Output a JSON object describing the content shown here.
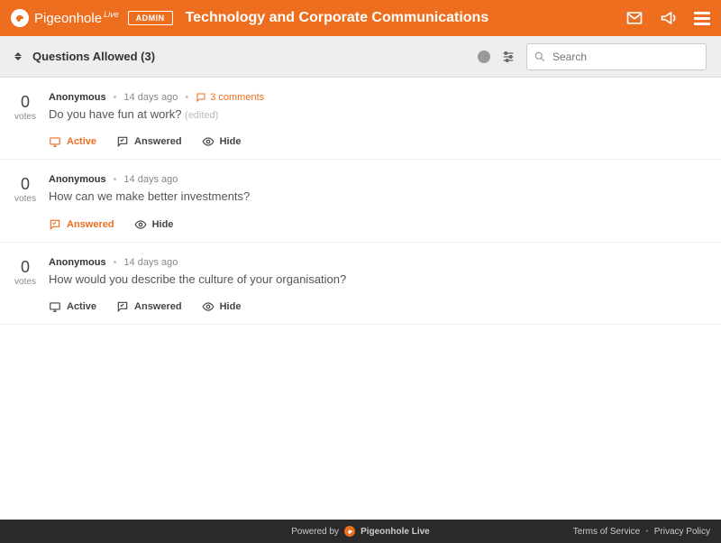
{
  "header": {
    "brand": "Pigeonhole",
    "brand_sup": "Live",
    "admin_badge": "ADMIN",
    "title": "Technology and Corporate Communications"
  },
  "subbar": {
    "title": "Questions Allowed (3)",
    "search_placeholder": "Search"
  },
  "questions": [
    {
      "votes": "0",
      "votes_label": "votes",
      "author": "Anonymous",
      "time": "14 days ago",
      "comments": "3 comments",
      "text": "Do you have fun at work?",
      "edited": "(edited)",
      "active": {
        "label": "Active",
        "on": true
      },
      "answered": {
        "label": "Answered",
        "on": false
      },
      "hide": {
        "label": "Hide",
        "on": false
      }
    },
    {
      "votes": "0",
      "votes_label": "votes",
      "author": "Anonymous",
      "time": "14 days ago",
      "comments": null,
      "text": "How can we make better investments?",
      "edited": null,
      "active": null,
      "answered": {
        "label": "Answered",
        "on": true
      },
      "hide": {
        "label": "Hide",
        "on": false
      }
    },
    {
      "votes": "0",
      "votes_label": "votes",
      "author": "Anonymous",
      "time": "14 days ago",
      "comments": null,
      "text": "How would you describe the culture of your organisation?",
      "edited": null,
      "active": {
        "label": "Active",
        "on": false
      },
      "answered": {
        "label": "Answered",
        "on": false
      },
      "hide": {
        "label": "Hide",
        "on": false
      }
    }
  ],
  "footer": {
    "powered": "Powered by",
    "brand": "Pigeonhole Live",
    "tos": "Terms of Service",
    "privacy": "Privacy Policy"
  }
}
